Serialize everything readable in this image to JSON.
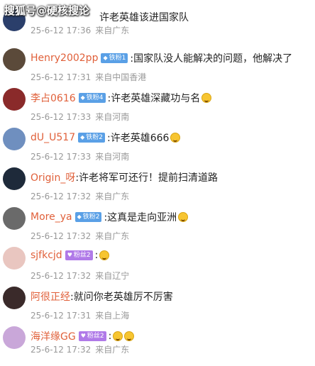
{
  "watermark": "搜狐号@硬核搜论",
  "comments": [
    {
      "username": "",
      "badge": "",
      "content": "许老英雄该进国家队",
      "date": "25-6-12 17:36",
      "location": "来自广东",
      "avatar_color": "#2b3f6b",
      "emoji": false
    },
    {
      "username": "Henry2002pp",
      "badge": "铁粉1",
      "content": ":国家队没人能解决的问题，他解决了",
      "date": "25-6-12 17:31",
      "location": "来自中国香港",
      "avatar_color": "#5b4a3a",
      "emoji": false
    },
    {
      "username": "李占0616",
      "badge": "铁粉4",
      "content": ":许老英雄深藏功与名",
      "date": "25-6-12 17:33",
      "location": "来自河南",
      "avatar_color": "#8a2a2a",
      "emoji": true
    },
    {
      "username": "dU_U517",
      "badge": "铁粉2",
      "content": ":许老英雄666",
      "date": "25-6-12 17:33",
      "location": "来自河南",
      "avatar_color": "#6f8fbf",
      "emoji": true
    },
    {
      "username": "Origin_呀",
      "badge": "",
      "content": ":许老将军可还行！提前扫清道路",
      "date": "25-6-12 17:32",
      "location": "来自广东",
      "avatar_color": "#1e2a3a",
      "emoji": false
    },
    {
      "username": "More_ya",
      "badge": "铁粉2",
      "content": ":这真是走向亚洲",
      "date": "25-6-12 17:32",
      "location": "来自广东",
      "avatar_color": "#6a6a6a",
      "emoji": true
    },
    {
      "username": "sjfkcjd",
      "badge": "粉丝2",
      "content": ":",
      "date": "25-6-12 17:32",
      "location": "来自辽宁",
      "avatar_color": "#e9c6c0",
      "emoji": true
    },
    {
      "username": "阿很正经",
      "badge": "",
      "content": ":就问你老英雄厉不厉害",
      "date": "25-6-12 17:31",
      "location": "来自上海",
      "avatar_color": "#3a2a2a",
      "emoji": false
    },
    {
      "username": "海洋缘GG",
      "badge": "粉丝2",
      "content": ":",
      "date": "25-6-12 17:32",
      "location": "来自广东",
      "avatar_color": "#c9a7d9",
      "emoji": true
    }
  ]
}
